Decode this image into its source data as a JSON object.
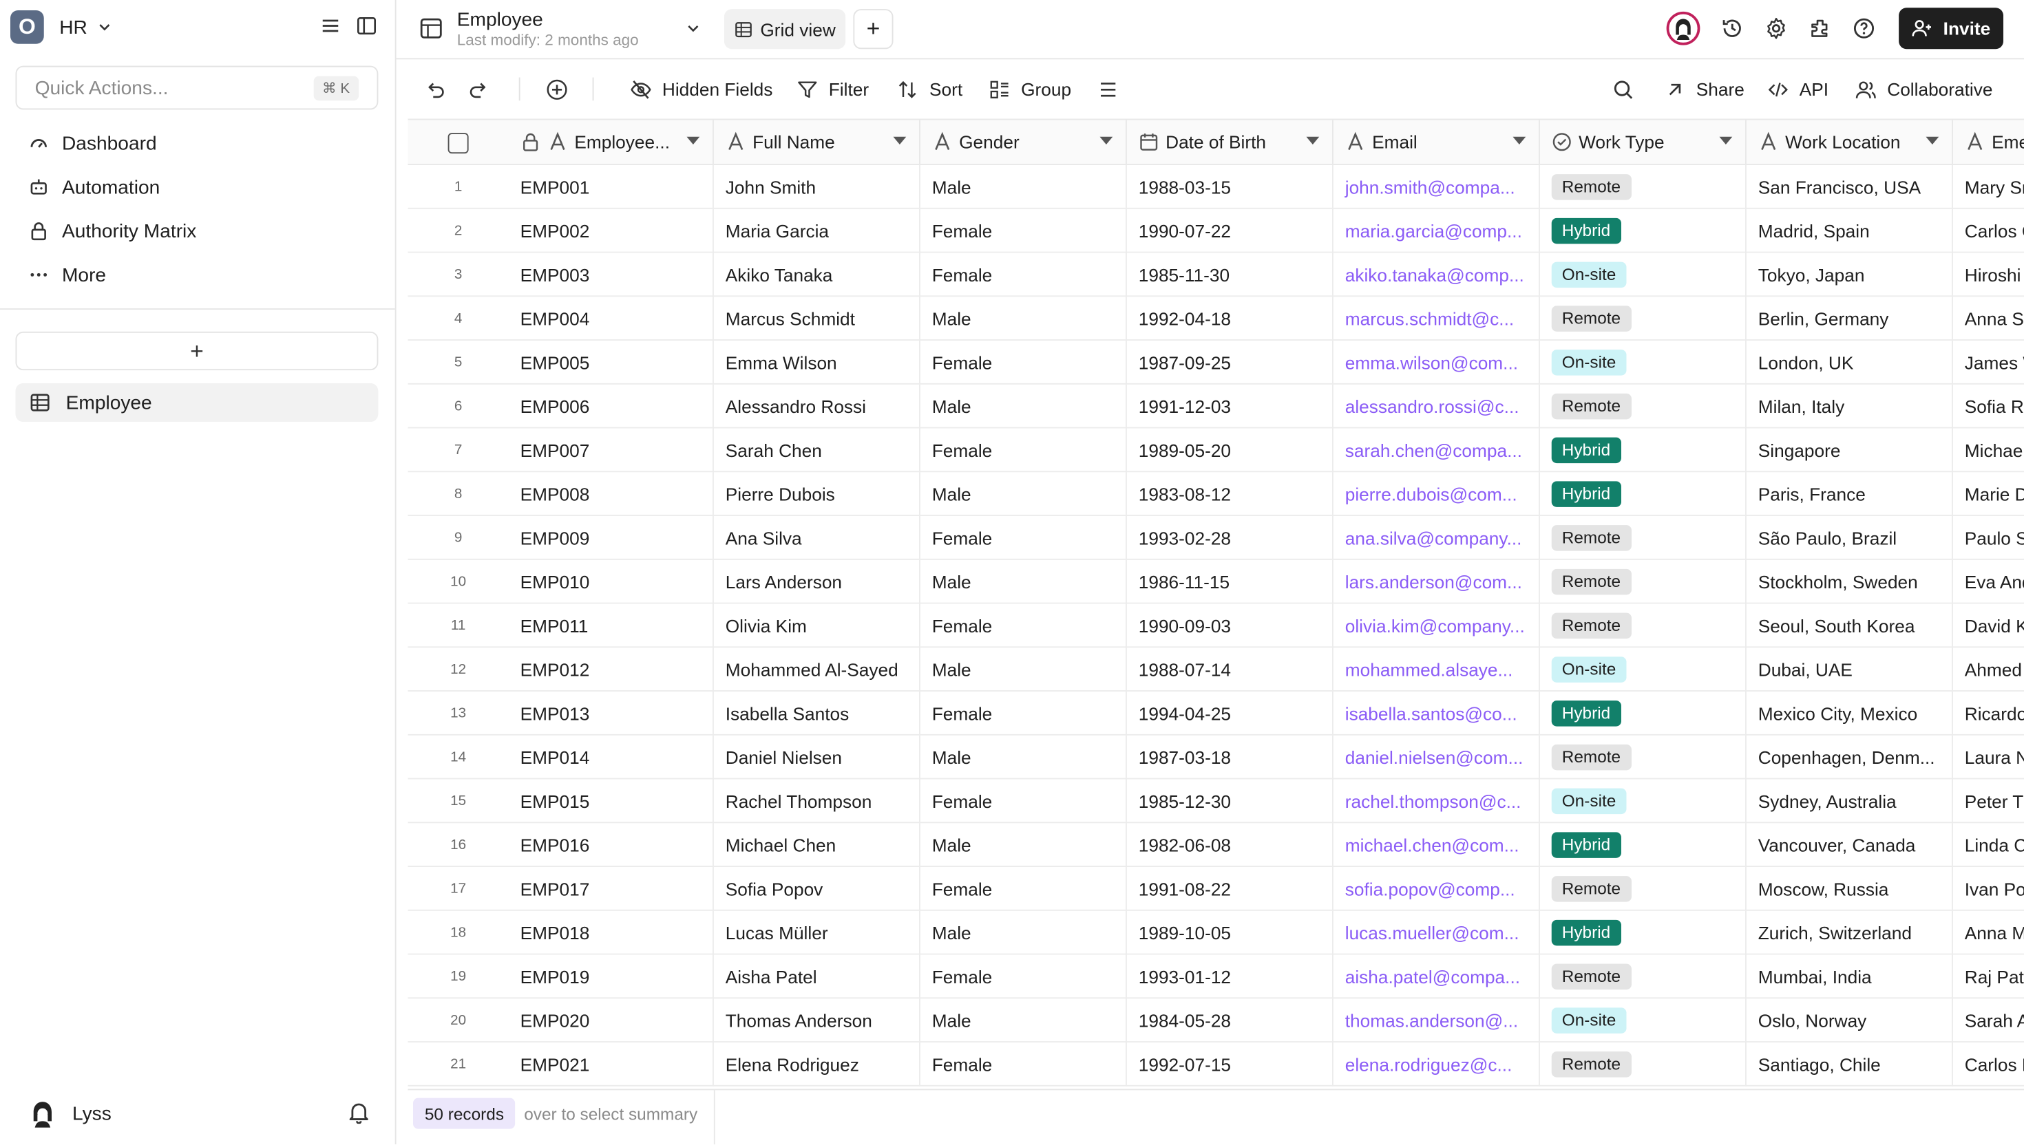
{
  "workspace": {
    "logo": "O",
    "name": "HR"
  },
  "sidebar": {
    "quick_actions_placeholder": "Quick Actions...",
    "quick_actions_shortcut": "⌘ K",
    "nav": [
      {
        "label": "Dashboard",
        "icon": "dashboard-icon"
      },
      {
        "label": "Automation",
        "icon": "robot-icon"
      },
      {
        "label": "Authority Matrix",
        "icon": "lock-icon"
      },
      {
        "label": "More",
        "icon": "more-icon"
      }
    ],
    "add_table_label": "+",
    "tables": [
      {
        "label": "Employee",
        "icon": "table-icon"
      }
    ],
    "user": {
      "name": "Lyss"
    }
  },
  "header": {
    "table_title": "Employee",
    "last_modified": "Last modify: 2 months ago",
    "view_label": "Grid view",
    "invite_label": "Invite"
  },
  "toolbar": {
    "hidden_fields": "Hidden Fields",
    "filter": "Filter",
    "sort": "Sort",
    "group": "Group",
    "share": "Share",
    "api": "API",
    "collaborative": "Collaborative"
  },
  "columns": [
    {
      "label": "Employee...",
      "type": "text",
      "locked": true
    },
    {
      "label": "Full Name",
      "type": "text"
    },
    {
      "label": "Gender",
      "type": "text"
    },
    {
      "label": "Date of Birth",
      "type": "date"
    },
    {
      "label": "Email",
      "type": "text"
    },
    {
      "label": "Work Type",
      "type": "select"
    },
    {
      "label": "Work Location",
      "type": "text"
    },
    {
      "label": "Eme",
      "type": "text"
    }
  ],
  "badge_colors": {
    "Remote": {
      "bg": "#e4e4e4",
      "fg": "#1f1f1f"
    },
    "Hybrid": {
      "bg": "#12806a",
      "fg": "#ffffff"
    },
    "On-site": {
      "bg": "#cdf3f7",
      "fg": "#1f1f1f"
    }
  },
  "rows": [
    {
      "n": "1",
      "id": "EMP001",
      "name": "John Smith",
      "gender": "Male",
      "dob": "1988-03-15",
      "email": "john.smith@compa...",
      "work_type": "Remote",
      "location": "San Francisco, USA",
      "emergency": "Mary Sm"
    },
    {
      "n": "2",
      "id": "EMP002",
      "name": "Maria Garcia",
      "gender": "Female",
      "dob": "1990-07-22",
      "email": "maria.garcia@comp...",
      "work_type": "Hybrid",
      "location": "Madrid, Spain",
      "emergency": "Carlos G"
    },
    {
      "n": "3",
      "id": "EMP003",
      "name": "Akiko Tanaka",
      "gender": "Female",
      "dob": "1985-11-30",
      "email": "akiko.tanaka@comp...",
      "work_type": "On-site",
      "location": "Tokyo, Japan",
      "emergency": "Hiroshi"
    },
    {
      "n": "4",
      "id": "EMP004",
      "name": "Marcus Schmidt",
      "gender": "Male",
      "dob": "1992-04-18",
      "email": "marcus.schmidt@c...",
      "work_type": "Remote",
      "location": "Berlin, Germany",
      "emergency": "Anna Sc"
    },
    {
      "n": "5",
      "id": "EMP005",
      "name": "Emma Wilson",
      "gender": "Female",
      "dob": "1987-09-25",
      "email": "emma.wilson@com...",
      "work_type": "On-site",
      "location": "London, UK",
      "emergency": "James W"
    },
    {
      "n": "6",
      "id": "EMP006",
      "name": "Alessandro Rossi",
      "gender": "Male",
      "dob": "1991-12-03",
      "email": "alessandro.rossi@c...",
      "work_type": "Remote",
      "location": "Milan, Italy",
      "emergency": "Sofia Ro"
    },
    {
      "n": "7",
      "id": "EMP007",
      "name": "Sarah Chen",
      "gender": "Female",
      "dob": "1989-05-20",
      "email": "sarah.chen@compa...",
      "work_type": "Hybrid",
      "location": "Singapore",
      "emergency": "Michael"
    },
    {
      "n": "8",
      "id": "EMP008",
      "name": "Pierre Dubois",
      "gender": "Male",
      "dob": "1983-08-12",
      "email": "pierre.dubois@com...",
      "work_type": "Hybrid",
      "location": "Paris, France",
      "emergency": "Marie D"
    },
    {
      "n": "9",
      "id": "EMP009",
      "name": "Ana Silva",
      "gender": "Female",
      "dob": "1993-02-28",
      "email": "ana.silva@company...",
      "work_type": "Remote",
      "location": "São Paulo, Brazil",
      "emergency": "Paulo S"
    },
    {
      "n": "10",
      "id": "EMP010",
      "name": "Lars Anderson",
      "gender": "Male",
      "dob": "1986-11-15",
      "email": "lars.anderson@com...",
      "work_type": "Remote",
      "location": "Stockholm, Sweden",
      "emergency": "Eva And"
    },
    {
      "n": "11",
      "id": "EMP011",
      "name": "Olivia Kim",
      "gender": "Female",
      "dob": "1990-09-03",
      "email": "olivia.kim@company...",
      "work_type": "Remote",
      "location": "Seoul, South Korea",
      "emergency": "David K"
    },
    {
      "n": "12",
      "id": "EMP012",
      "name": "Mohammed Al-Sayed",
      "gender": "Male",
      "dob": "1988-07-14",
      "email": "mohammed.alsaye...",
      "work_type": "On-site",
      "location": "Dubai, UAE",
      "emergency": "Ahmed"
    },
    {
      "n": "13",
      "id": "EMP013",
      "name": "Isabella Santos",
      "gender": "Female",
      "dob": "1994-04-25",
      "email": "isabella.santos@co...",
      "work_type": "Hybrid",
      "location": "Mexico City, Mexico",
      "emergency": "Ricardo"
    },
    {
      "n": "14",
      "id": "EMP014",
      "name": "Daniel Nielsen",
      "gender": "Male",
      "dob": "1987-03-18",
      "email": "daniel.nielsen@com...",
      "work_type": "Remote",
      "location": "Copenhagen, Denm...",
      "emergency": "Laura N"
    },
    {
      "n": "15",
      "id": "EMP015",
      "name": "Rachel Thompson",
      "gender": "Female",
      "dob": "1985-12-30",
      "email": "rachel.thompson@c...",
      "work_type": "On-site",
      "location": "Sydney, Australia",
      "emergency": "Peter T"
    },
    {
      "n": "16",
      "id": "EMP016",
      "name": "Michael Chen",
      "gender": "Male",
      "dob": "1982-06-08",
      "email": "michael.chen@com...",
      "work_type": "Hybrid",
      "location": "Vancouver, Canada",
      "emergency": "Linda C"
    },
    {
      "n": "17",
      "id": "EMP017",
      "name": "Sofia Popov",
      "gender": "Female",
      "dob": "1991-08-22",
      "email": "sofia.popov@comp...",
      "work_type": "Remote",
      "location": "Moscow, Russia",
      "emergency": "Ivan Po"
    },
    {
      "n": "18",
      "id": "EMP018",
      "name": "Lucas Müller",
      "gender": "Male",
      "dob": "1989-10-05",
      "email": "lucas.mueller@com...",
      "work_type": "Hybrid",
      "location": "Zurich, Switzerland",
      "emergency": "Anna M"
    },
    {
      "n": "19",
      "id": "EMP019",
      "name": "Aisha Patel",
      "gender": "Female",
      "dob": "1993-01-12",
      "email": "aisha.patel@compa...",
      "work_type": "Remote",
      "location": "Mumbai, India",
      "emergency": "Raj Pate"
    },
    {
      "n": "20",
      "id": "EMP020",
      "name": "Thomas Anderson",
      "gender": "Male",
      "dob": "1984-05-28",
      "email": "thomas.anderson@...",
      "work_type": "On-site",
      "location": "Oslo, Norway",
      "emergency": "Sarah A"
    },
    {
      "n": "21",
      "id": "EMP021",
      "name": "Elena Rodriguez",
      "gender": "Female",
      "dob": "1992-07-15",
      "email": "elena.rodriguez@c...",
      "work_type": "Remote",
      "location": "Santiago, Chile",
      "emergency": "Carlos R"
    }
  ],
  "footer": {
    "records": "50 records",
    "summary_hint": "over to select summary"
  }
}
